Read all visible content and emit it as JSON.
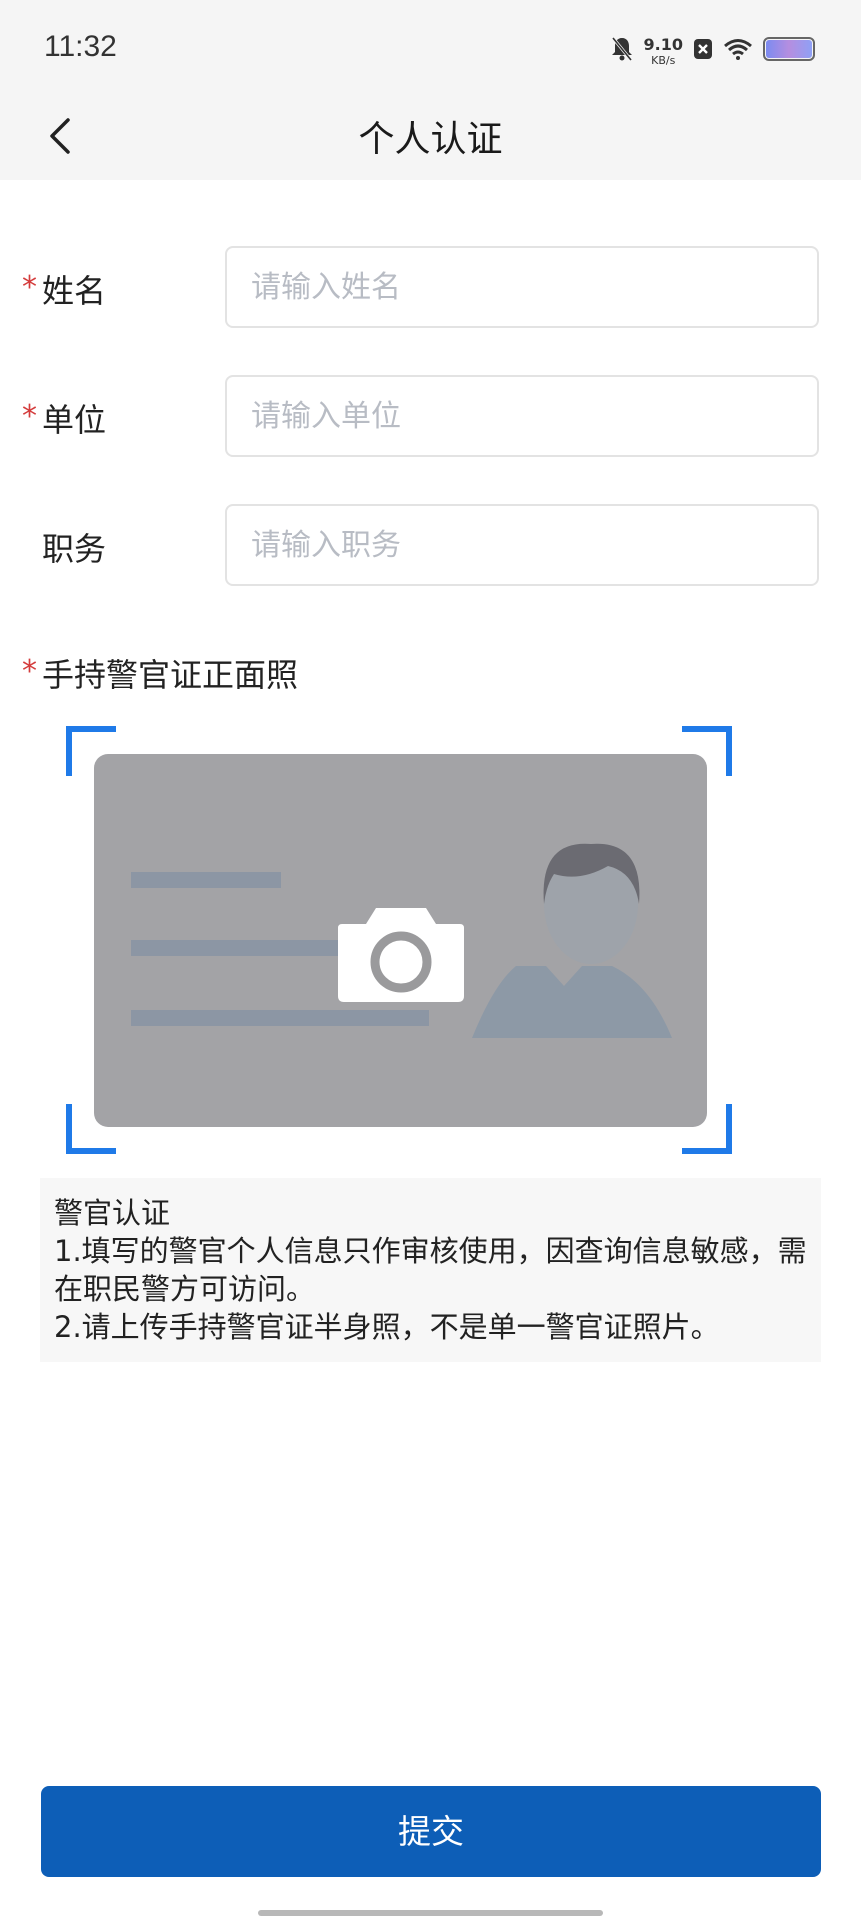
{
  "status_bar": {
    "time": "11:32",
    "network_speed_value": "9.10",
    "network_speed_unit": "KB/s",
    "icons": [
      "bell-muted-icon",
      "sim-x-icon",
      "wifi-icon",
      "battery-icon"
    ]
  },
  "header": {
    "title": "个人认证",
    "back_icon": "chevron-left-icon"
  },
  "form": {
    "required_mark": "*",
    "name": {
      "label": "姓名",
      "placeholder": "请输入姓名",
      "value": "",
      "required": true
    },
    "unit": {
      "label": "单位",
      "placeholder": "请输入单位",
      "value": "",
      "required": true
    },
    "position": {
      "label": "职务",
      "placeholder": "请输入职务",
      "value": "",
      "required": false
    },
    "photo": {
      "label": "手持警官证正面照",
      "required": true,
      "icon": "camera-icon"
    }
  },
  "notice": {
    "title": "警官认证",
    "line1": "1.填写的警官个人信息只作审核使用，因查询信息敏感，需在职民警方可访问。",
    "line2": "2.请上传手持警官证半身照，不是单一警官证照片。"
  },
  "submit": {
    "label": "提交"
  },
  "colors": {
    "accent": "#0d5eb7",
    "corner_blue": "#1f7ae8",
    "required_red": "#d43c3c",
    "card_gray": "#a3a3a6"
  }
}
